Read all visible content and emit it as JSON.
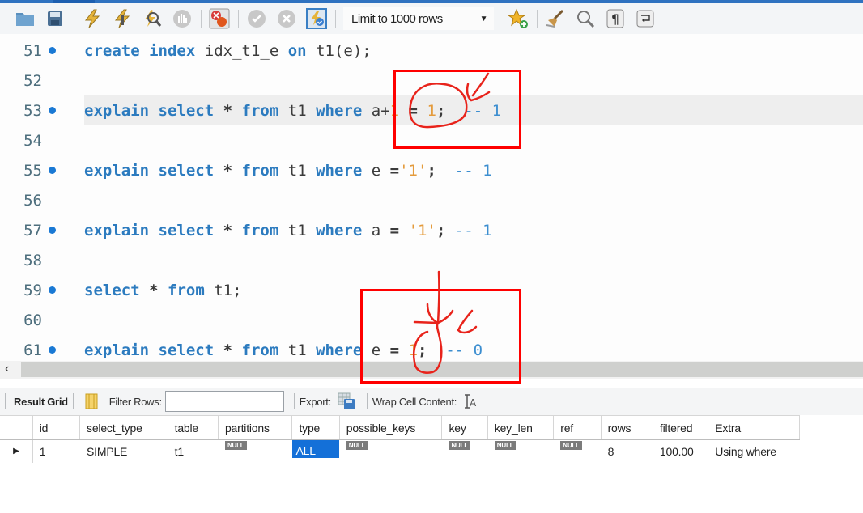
{
  "toolbar": {
    "icons": [
      "open-folder-icon",
      "save-icon",
      "execute-icon",
      "execute-current-icon",
      "explain-icon",
      "stop-icon",
      "toggle-error-stop-icon",
      "commit-icon",
      "rollback-icon",
      "autocommit-icon",
      "add-snippet-icon",
      "beautify-icon",
      "find-icon",
      "invisible-chars-icon",
      "wrap-icon"
    ],
    "limit_select": "Limit to 1000 rows"
  },
  "editor": {
    "lines": [
      {
        "num": "51",
        "statement": true,
        "highlighted": false,
        "tokens": [
          {
            "t": "kw",
            "v": "create"
          },
          {
            "t": "sp",
            "v": " "
          },
          {
            "t": "kw",
            "v": "index"
          },
          {
            "t": "sp",
            "v": " "
          },
          {
            "t": "id",
            "v": "idx_t1_e"
          },
          {
            "t": "sp",
            "v": " "
          },
          {
            "t": "kw",
            "v": "on"
          },
          {
            "t": "sp",
            "v": " "
          },
          {
            "t": "id",
            "v": "t1(e);"
          }
        ]
      },
      {
        "num": "52",
        "statement": false,
        "highlighted": false,
        "tokens": []
      },
      {
        "num": "53",
        "statement": true,
        "highlighted": true,
        "tokens": [
          {
            "t": "kw",
            "v": "explain"
          },
          {
            "t": "sp",
            "v": " "
          },
          {
            "t": "kw",
            "v": "select"
          },
          {
            "t": "sp",
            "v": " "
          },
          {
            "t": "op",
            "v": "*"
          },
          {
            "t": "sp",
            "v": " "
          },
          {
            "t": "kw",
            "v": "from"
          },
          {
            "t": "sp",
            "v": " "
          },
          {
            "t": "id",
            "v": "t1"
          },
          {
            "t": "sp",
            "v": " "
          },
          {
            "t": "kw",
            "v": "where"
          },
          {
            "t": "sp",
            "v": " "
          },
          {
            "t": "id",
            "v": "a+"
          },
          {
            "t": "num",
            "v": "1"
          },
          {
            "t": "sp",
            "v": " "
          },
          {
            "t": "op",
            "v": "="
          },
          {
            "t": "sp",
            "v": " "
          },
          {
            "t": "num",
            "v": "1"
          },
          {
            "t": "op",
            "v": ";"
          },
          {
            "t": "sp",
            "v": "  "
          },
          {
            "t": "cm",
            "v": "-- 1"
          }
        ]
      },
      {
        "num": "54",
        "statement": false,
        "highlighted": false,
        "tokens": []
      },
      {
        "num": "55",
        "statement": true,
        "highlighted": false,
        "tokens": [
          {
            "t": "kw",
            "v": "explain"
          },
          {
            "t": "sp",
            "v": " "
          },
          {
            "t": "kw",
            "v": "select"
          },
          {
            "t": "sp",
            "v": " "
          },
          {
            "t": "op",
            "v": "*"
          },
          {
            "t": "sp",
            "v": " "
          },
          {
            "t": "kw",
            "v": "from"
          },
          {
            "t": "sp",
            "v": " "
          },
          {
            "t": "id",
            "v": "t1"
          },
          {
            "t": "sp",
            "v": " "
          },
          {
            "t": "kw",
            "v": "where"
          },
          {
            "t": "sp",
            "v": " "
          },
          {
            "t": "id",
            "v": "e"
          },
          {
            "t": "sp",
            "v": " "
          },
          {
            "t": "op",
            "v": "="
          },
          {
            "t": "str",
            "v": "'1'"
          },
          {
            "t": "op",
            "v": ";"
          },
          {
            "t": "sp",
            "v": "  "
          },
          {
            "t": "cm",
            "v": "-- 1"
          }
        ]
      },
      {
        "num": "56",
        "statement": false,
        "highlighted": false,
        "tokens": []
      },
      {
        "num": "57",
        "statement": true,
        "highlighted": false,
        "tokens": [
          {
            "t": "kw",
            "v": "explain"
          },
          {
            "t": "sp",
            "v": " "
          },
          {
            "t": "kw",
            "v": "select"
          },
          {
            "t": "sp",
            "v": " "
          },
          {
            "t": "op",
            "v": "*"
          },
          {
            "t": "sp",
            "v": " "
          },
          {
            "t": "kw",
            "v": "from"
          },
          {
            "t": "sp",
            "v": " "
          },
          {
            "t": "id",
            "v": "t1"
          },
          {
            "t": "sp",
            "v": " "
          },
          {
            "t": "kw",
            "v": "where"
          },
          {
            "t": "sp",
            "v": " "
          },
          {
            "t": "id",
            "v": "a"
          },
          {
            "t": "sp",
            "v": " "
          },
          {
            "t": "op",
            "v": "="
          },
          {
            "t": "sp",
            "v": " "
          },
          {
            "t": "str",
            "v": "'1'"
          },
          {
            "t": "op",
            "v": ";"
          },
          {
            "t": "sp",
            "v": " "
          },
          {
            "t": "cm",
            "v": "-- 1"
          }
        ]
      },
      {
        "num": "58",
        "statement": false,
        "highlighted": false,
        "tokens": []
      },
      {
        "num": "59",
        "statement": true,
        "highlighted": false,
        "tokens": [
          {
            "t": "kw",
            "v": "select"
          },
          {
            "t": "sp",
            "v": " "
          },
          {
            "t": "op",
            "v": "*"
          },
          {
            "t": "sp",
            "v": " "
          },
          {
            "t": "kw",
            "v": "from"
          },
          {
            "t": "sp",
            "v": " "
          },
          {
            "t": "id",
            "v": "t1;"
          }
        ]
      },
      {
        "num": "60",
        "statement": false,
        "highlighted": false,
        "tokens": []
      },
      {
        "num": "61",
        "statement": true,
        "highlighted": false,
        "tokens": [
          {
            "t": "kw",
            "v": "explain"
          },
          {
            "t": "sp",
            "v": " "
          },
          {
            "t": "kw",
            "v": "select"
          },
          {
            "t": "sp",
            "v": " "
          },
          {
            "t": "op",
            "v": "*"
          },
          {
            "t": "sp",
            "v": " "
          },
          {
            "t": "kw",
            "v": "from"
          },
          {
            "t": "sp",
            "v": " "
          },
          {
            "t": "id",
            "v": "t1"
          },
          {
            "t": "sp",
            "v": " "
          },
          {
            "t": "kw",
            "v": "where"
          },
          {
            "t": "sp",
            "v": " "
          },
          {
            "t": "id",
            "v": "e"
          },
          {
            "t": "sp",
            "v": " "
          },
          {
            "t": "op",
            "v": "="
          },
          {
            "t": "sp",
            "v": " "
          },
          {
            "t": "num",
            "v": "1"
          },
          {
            "t": "op",
            "v": ";"
          },
          {
            "t": "sp",
            "v": "  "
          },
          {
            "t": "cm",
            "v": "-- 0"
          }
        ]
      }
    ]
  },
  "results_toolbar": {
    "result_grid_label": "Result Grid",
    "filter_label": "Filter Rows:",
    "filter_value": "",
    "export_label": "Export:",
    "wrap_label": "Wrap Cell Content:"
  },
  "grid": {
    "columns": [
      "id",
      "select_type",
      "table",
      "partitions",
      "type",
      "possible_keys",
      "key",
      "key_len",
      "ref",
      "rows",
      "filtered",
      "Extra"
    ],
    "rows": [
      [
        "1",
        "SIMPLE",
        "t1",
        "NULL",
        "ALL",
        "NULL",
        "NULL",
        "NULL",
        "NULL",
        "8",
        "100.00",
        "Using where"
      ]
    ],
    "selected_cell": {
      "row": 0,
      "col": "type"
    },
    "null_label": "NULL"
  },
  "colors": {
    "keyword": "#2c7bbf",
    "literal": "#e49b3c",
    "comment": "#3c8ed0",
    "selection": "#1470d8",
    "annotation": "#ff0000"
  }
}
